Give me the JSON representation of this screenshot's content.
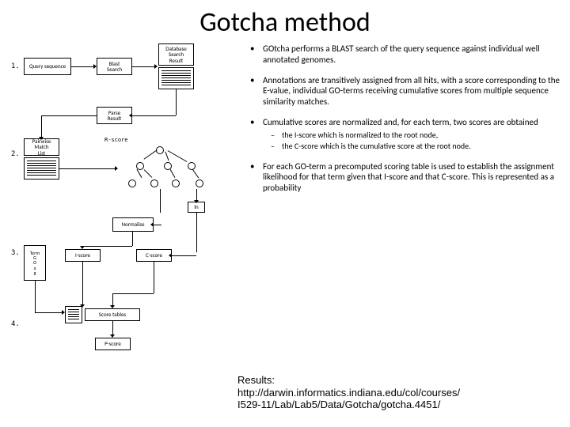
{
  "title": "Gotcha method",
  "bullets": [
    {
      "text": "GOtcha performs a BLAST search of the query sequence against individual well annotated genomes."
    },
    {
      "text": "Annotations are transitively assigned from all hits, with a score corresponding to the E-value, individual GO-terms receiving cumulative scores from multiple sequence similarity matches."
    },
    {
      "text": "Cumulative scores are normalized and, for each term, two scores are obtained",
      "sub": [
        "the I-score which is normalized to the root node,",
        "the C-score which is the cumulative score at the root node."
      ]
    },
    {
      "text": "For each GO-term a precomputed scoring table is used to establish the assignment likelihood for that term given that I-score and that C-score. This is represented as a probability"
    }
  ],
  "footer": {
    "label": "Results:",
    "url_line1": "http://darwin.informatics.indiana.edu/col/courses/",
    "url_line2": "I529-11/Lab/Lab5/Data/Gotcha/gotcha.4451/"
  },
  "diagram": {
    "steps": [
      "1.",
      "2.",
      "3.",
      "4."
    ],
    "boxes": {
      "query": "Query sequence",
      "blast": "Blast\nSearch",
      "dbsearch": "Database\nSearch\nResult",
      "parse": "Parse\nResult",
      "pairwise": "Pairwise\nMatch\nList",
      "rscore": "R-score",
      "normalise": "Normalise",
      "ln": "ln",
      "iscore": "I-score",
      "cscore": "C-score",
      "term_go": "Term\nG\nO\na\ng",
      "scoretables": "Score tables",
      "pscore": "P-score"
    }
  }
}
